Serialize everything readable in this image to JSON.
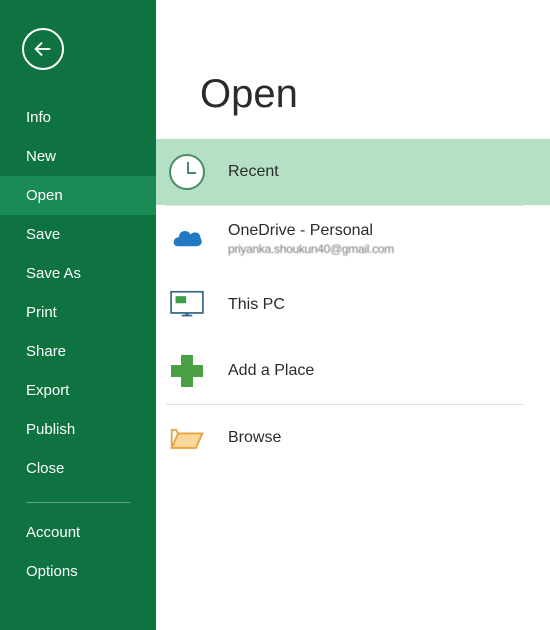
{
  "sidebar": {
    "items": [
      {
        "label": "Info",
        "active": false
      },
      {
        "label": "New",
        "active": false
      },
      {
        "label": "Open",
        "active": true
      },
      {
        "label": "Save",
        "active": false
      },
      {
        "label": "Save As",
        "active": false
      },
      {
        "label": "Print",
        "active": false
      },
      {
        "label": "Share",
        "active": false
      },
      {
        "label": "Export",
        "active": false
      },
      {
        "label": "Publish",
        "active": false
      },
      {
        "label": "Close",
        "active": false
      }
    ],
    "footer": [
      {
        "label": "Account"
      },
      {
        "label": "Options"
      }
    ]
  },
  "main": {
    "title": "Open",
    "locations": [
      {
        "label": "Recent",
        "active": true
      },
      {
        "label": "OneDrive - Personal",
        "sublabel": "priyanka.shoukun40@gmail.com"
      },
      {
        "label": "This PC"
      },
      {
        "label": "Add a Place"
      },
      {
        "label": "Browse"
      }
    ]
  }
}
